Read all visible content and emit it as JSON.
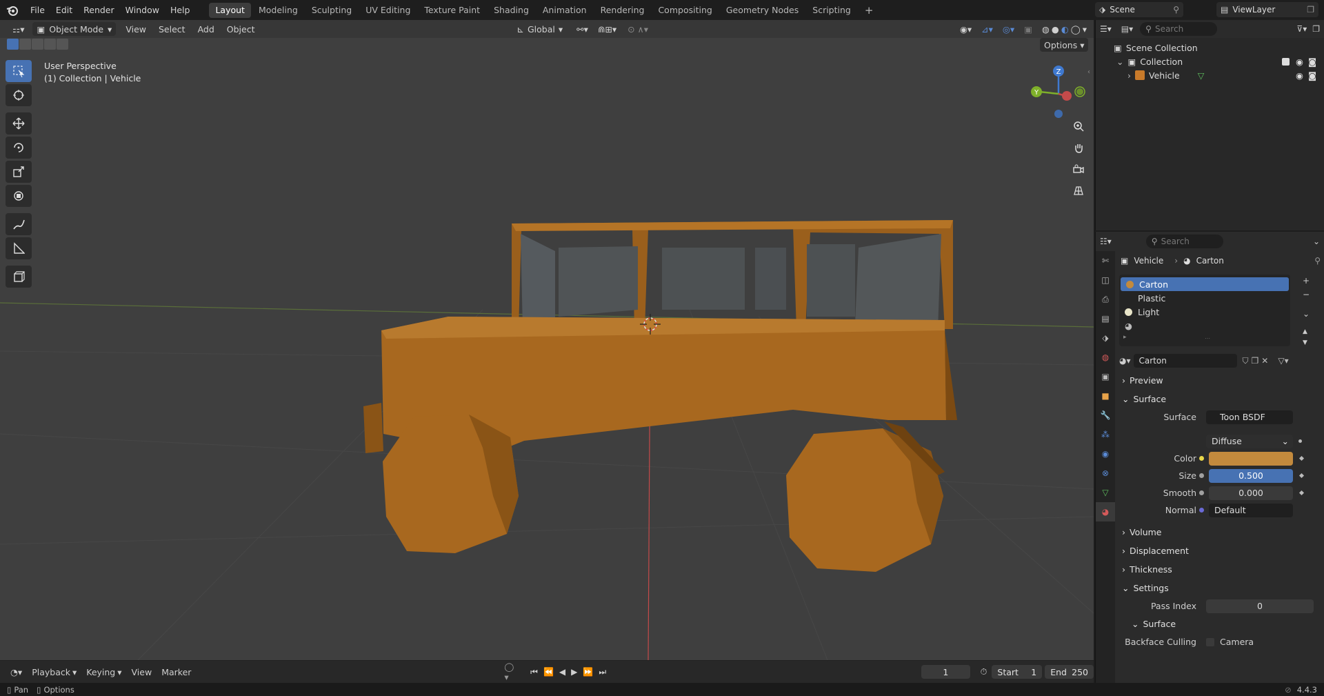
{
  "menu": {
    "items": [
      "File",
      "Edit",
      "Render",
      "Window",
      "Help"
    ]
  },
  "workspaces": {
    "tabs": [
      "Layout",
      "Modeling",
      "Sculpting",
      "UV Editing",
      "Texture Paint",
      "Shading",
      "Animation",
      "Rendering",
      "Compositing",
      "Geometry Nodes",
      "Scripting"
    ],
    "active": "Layout",
    "add": "+"
  },
  "scene": {
    "name": "Scene"
  },
  "view_layer": {
    "name": "ViewLayer"
  },
  "viewport": {
    "mode": "Object Mode",
    "menus": [
      "View",
      "Select",
      "Add",
      "Object"
    ],
    "orientation": "Global",
    "options_label": "Options",
    "perspective": "User Perspective",
    "collection_line": "(1) Collection | Vehicle",
    "gizmo": {
      "z": "Z",
      "y": "Y"
    }
  },
  "colors": {
    "vehicle_body": "#a8681f",
    "vehicle_dark": "#8a5416",
    "selection_blue": "#4772b3",
    "x_axis": "#c44a4a",
    "y_axis": "#7fb02a",
    "z_axis": "#3f79d0",
    "carton_swatch": "#c38a3d"
  },
  "timeline": {
    "menus": [
      "Playback",
      "Keying",
      "View",
      "Marker"
    ],
    "current_frame": "1",
    "start_label": "Start",
    "start": "1",
    "end_label": "End",
    "end": "250"
  },
  "statusbar": {
    "pan": "Pan",
    "options": "Options",
    "version": "4.4.3"
  },
  "outliner": {
    "search_placeholder": "Search",
    "scene_collection": "Scene Collection",
    "collection": "Collection",
    "object": "Vehicle"
  },
  "properties": {
    "search_placeholder": "Search",
    "breadcrumb": [
      "Vehicle",
      "Carton"
    ],
    "material_slots": [
      "Carton",
      "Plastic",
      "Light"
    ],
    "material_name": "Carton",
    "panels": {
      "preview": "Preview",
      "surface": "Surface",
      "volume": "Volume",
      "displacement": "Displacement",
      "thickness": "Thickness",
      "settings": "Settings",
      "surface_sub": "Surface"
    },
    "surface": {
      "surface_label": "Surface",
      "surface_value": "Toon BSDF",
      "component": "Diffuse",
      "color_label": "Color",
      "size_label": "Size",
      "size_value": "0.500",
      "smooth_label": "Smooth",
      "smooth_value": "0.000",
      "normal_label": "Normal",
      "normal_value": "Default"
    },
    "settings": {
      "pass_index_label": "Pass Index",
      "pass_index_value": "0",
      "backface_label": "Backface Culling",
      "camera_label": "Camera"
    }
  }
}
